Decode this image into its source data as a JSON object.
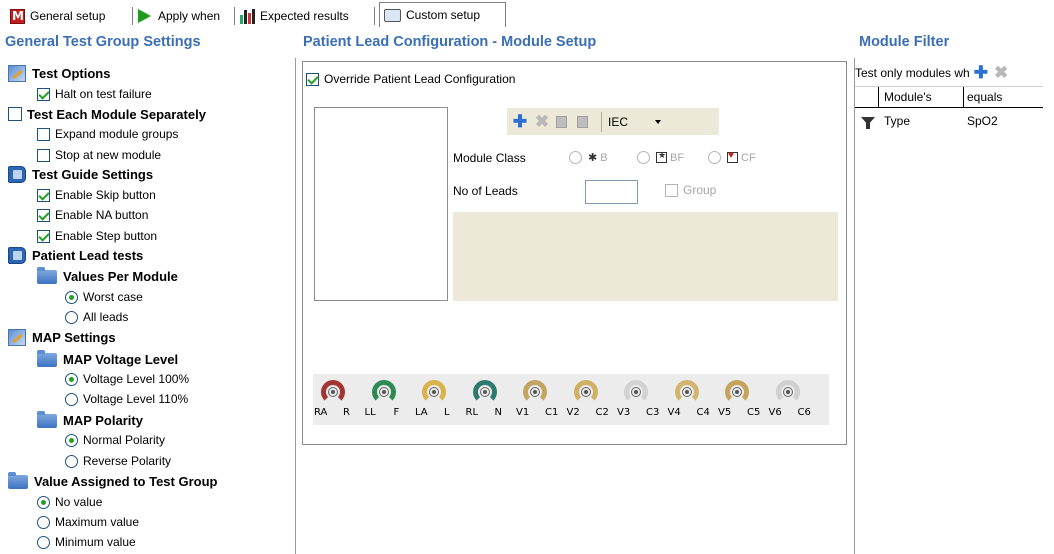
{
  "tabs": [
    {
      "label": "General setup",
      "icon": "m-logo-icon"
    },
    {
      "label": "Apply when",
      "icon": "play-icon"
    },
    {
      "label": "Expected results",
      "icon": "bars-icon"
    },
    {
      "label": "Custom setup",
      "icon": "screen-icon",
      "active": true
    }
  ],
  "left": {
    "title": "General Test Group Settings",
    "test_options": "Test Options",
    "halt_on_failure": "Halt on test failure",
    "test_each_module": "Test Each Module Separately",
    "expand_groups": "Expand module groups",
    "stop_at_new": "Stop at new module",
    "guide_settings": "Test Guide Settings",
    "enable_skip": "Enable Skip button",
    "enable_na": "Enable NA button",
    "enable_step": "Enable Step button",
    "patient_lead_tests": "Patient Lead tests",
    "values_per_module": "Values Per Module",
    "worst_case": "Worst case",
    "all_leads": "All leads",
    "map_settings": "MAP Settings",
    "map_voltage": "MAP Voltage Level",
    "volt_100": "Voltage Level 100%",
    "volt_110": "Voltage Level 110%",
    "map_polarity": "MAP Polarity",
    "normal_polarity": "Normal Polarity",
    "reverse_polarity": "Reverse Polarity",
    "value_assigned": "Value Assigned to Test Group",
    "no_value": "No value",
    "max_value": "Maximum value",
    "min_value": "Minimum value"
  },
  "middle": {
    "title": "Patient Lead Configuration - Module Setup",
    "override": "Override Patient Lead Configuration",
    "standard": "IEC",
    "module_class": "Module Class",
    "class_b": "B",
    "class_bf": "BF",
    "class_cf": "CF",
    "no_of_leads": "No of Leads",
    "no_of_leads_value": "",
    "group": "Group",
    "cables": [
      {
        "a": "RA",
        "b": "R",
        "color": "#a33535"
      },
      {
        "a": "LL",
        "b": "F",
        "color": "#2d8a52"
      },
      {
        "a": "LA",
        "b": "L",
        "color": "#d9b24a"
      },
      {
        "a": "RL",
        "b": "N",
        "color": "#2f7a6e"
      },
      {
        "a": "V1",
        "b": "C1",
        "color": "#c4a463"
      },
      {
        "a": "V2",
        "b": "C2",
        "color": "#d0b062"
      },
      {
        "a": "V3",
        "b": "C3",
        "color": "#d2d2d2"
      },
      {
        "a": "V4",
        "b": "C4",
        "color": "#d3b46c"
      },
      {
        "a": "V5",
        "b": "C5",
        "color": "#c6a35c"
      },
      {
        "a": "V6",
        "b": "C6",
        "color": "#d0d0d0"
      }
    ]
  },
  "right": {
    "title": "Module Filter",
    "filter_text": "Test only modules wh",
    "col_module": "Module's",
    "col_equals": "equals",
    "rows": [
      {
        "module": "Type",
        "value": "SpO2"
      }
    ]
  }
}
